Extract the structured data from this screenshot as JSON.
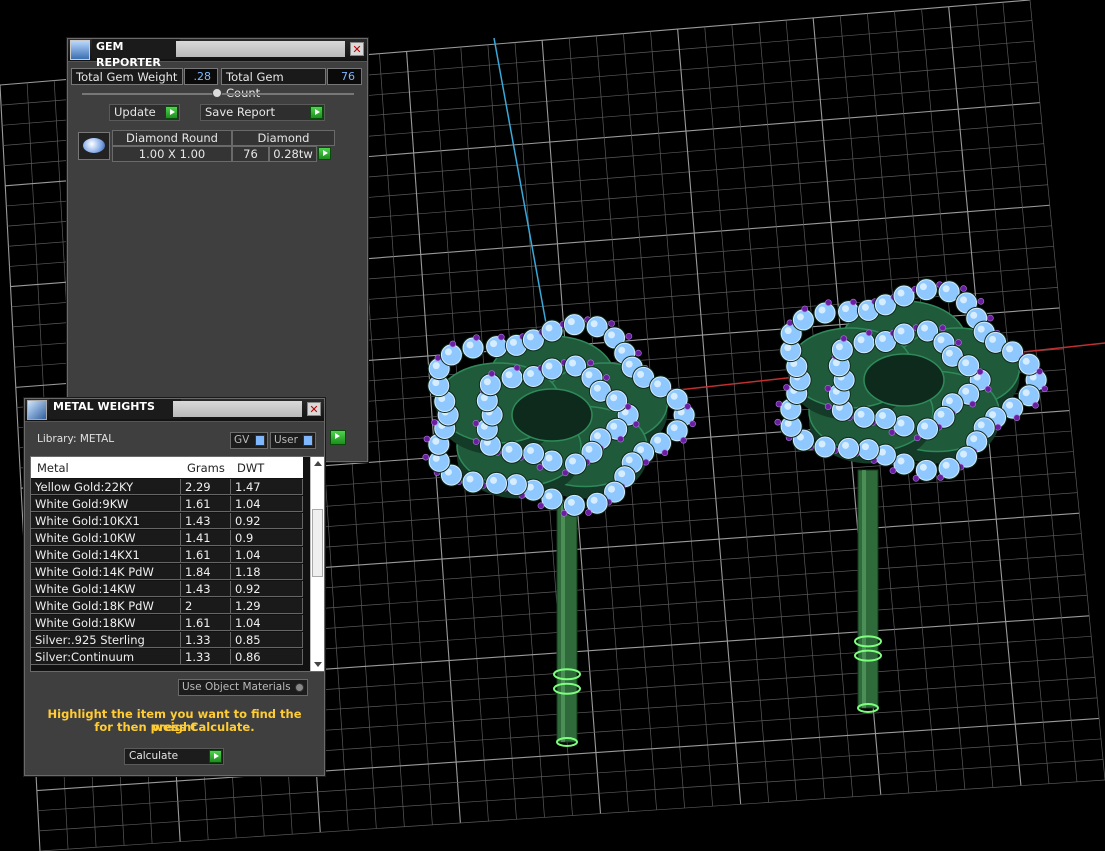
{
  "gem_reporter": {
    "title": "GEM REPORTER",
    "total_weight_label": "Total Gem Weight",
    "total_weight_value": ".28",
    "total_count_label": "Total Gem Count",
    "total_count_value": "76",
    "update_label": "Update",
    "save_report_label": "Save Report",
    "gem_row": {
      "shape": "Diamond Round",
      "material": "Diamond",
      "size": "1.00 X 1.00",
      "count": "76",
      "weight": "0.28tw"
    }
  },
  "metal_weights": {
    "title": "METAL WEIGHTS",
    "library_label": "Library: METAL",
    "gv_label": "GV",
    "user_label": "User",
    "columns": [
      "Metal",
      "Grams",
      "DWT"
    ],
    "rows": [
      {
        "metal": "Yellow Gold:22KY",
        "grams": "2.29",
        "dwt": "1.47"
      },
      {
        "metal": "White Gold:9KW",
        "grams": "1.61",
        "dwt": "1.04"
      },
      {
        "metal": "White Gold:10KX1",
        "grams": "1.43",
        "dwt": "0.92"
      },
      {
        "metal": "White Gold:10KW",
        "grams": "1.41",
        "dwt": "0.9"
      },
      {
        "metal": "White Gold:14KX1",
        "grams": "1.61",
        "dwt": "1.04"
      },
      {
        "metal": "White Gold:14K PdW",
        "grams": "1.84",
        "dwt": "1.18"
      },
      {
        "metal": "White Gold:14KW",
        "grams": "1.43",
        "dwt": "0.92"
      },
      {
        "metal": "White Gold:18K PdW",
        "grams": "2",
        "dwt": "1.29"
      },
      {
        "metal": "White Gold:18KW",
        "grams": "1.61",
        "dwt": "1.04"
      },
      {
        "metal": "Silver:.925 Sterling",
        "grams": "1.33",
        "dwt": "0.85"
      },
      {
        "metal": "Silver:Continuum",
        "grams": "1.33",
        "dwt": "0.86"
      }
    ],
    "use_object_materials_label": "Use Object Materials",
    "hint_line1": "Highlight the item you want to find the weight",
    "hint_line2": "for then press Calculate.",
    "calculate_label": "Calculate"
  },
  "colors": {
    "accent_value": "#7fb8ff",
    "play_green": "#2fb52f",
    "hint_yellow": "#ffcc33",
    "gem_blue": "#8ec8ff",
    "prong_purple": "#6a1fa0",
    "metal_green": "#1f5a3a"
  }
}
